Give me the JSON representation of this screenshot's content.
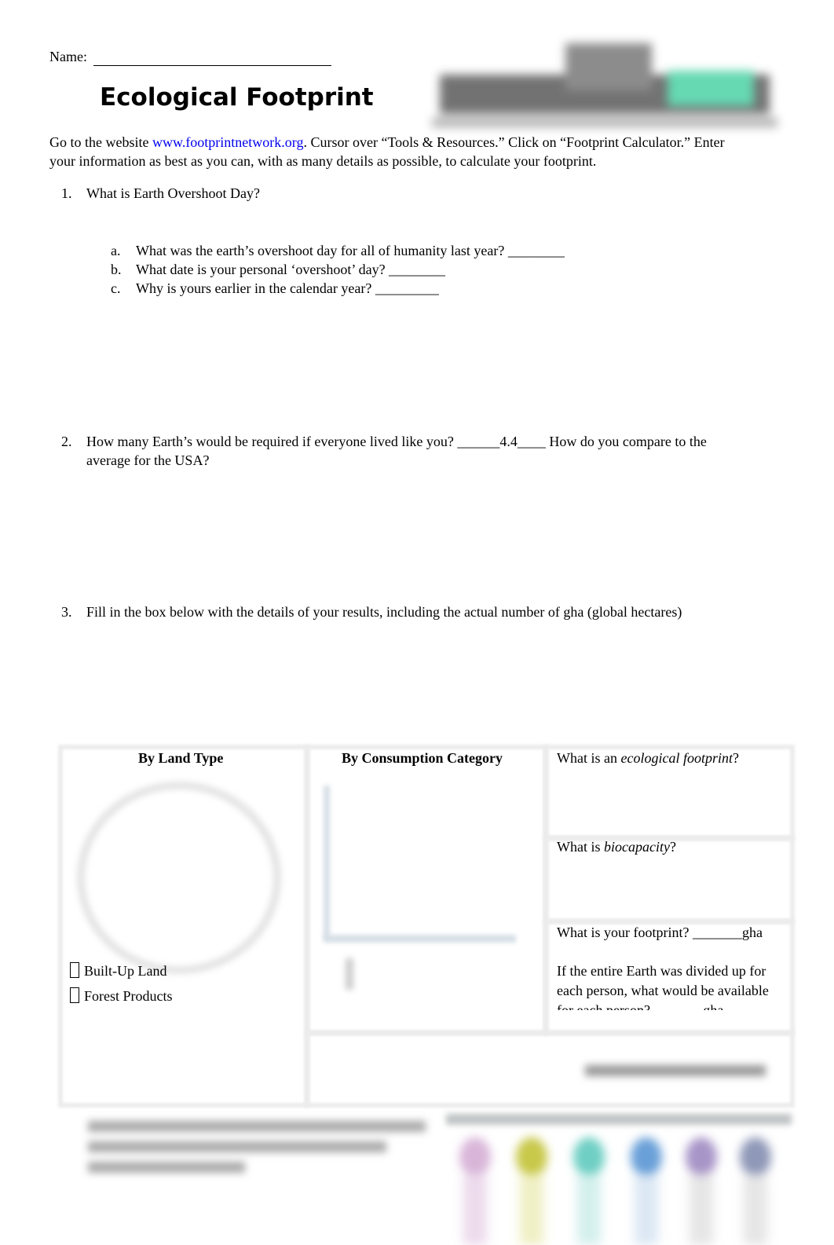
{
  "header": {
    "name_label": "Name:",
    "title": "Ecological Footprint"
  },
  "intro": {
    "pre": "Go to the website ",
    "link": "www.footprintnetwork.org",
    "post": ". Cursor over “Tools & Resources.” Click on “Footprint Calculator.” Enter",
    "line2": "your information as best as you can, with as many details as possible, to calculate your footprint."
  },
  "questions": [
    {
      "num": "1.",
      "text": "What is Earth Overshoot Day?",
      "sub": [
        {
          "letter": "a.",
          "text": "What was the earth’s overshoot day for all of humanity last year? ________"
        },
        {
          "letter": "b.",
          "text": "What date is your personal ‘overshoot’ day? ________"
        },
        {
          "letter": "c.",
          "text": "Why is yours earlier in the calendar year?  _________"
        }
      ]
    },
    {
      "num": "2.",
      "text": "How many Earth’s would be required if everyone lived like you? ______4.4____ How do you compare to the",
      "text2": "average for the USA?"
    },
    {
      "num": "3.",
      "text": "Fill in the box below with the details of your results, including the actual number of gha (global hectares)"
    }
  ],
  "box": {
    "land_type_header": "By Land Type",
    "consumption_header": "By Consumption Category",
    "legend": [
      "Built-Up Land",
      "Forest Products"
    ],
    "q_eco_pre": "What is an ",
    "q_eco_em": "ecological footprint",
    "q_eco_post": "?",
    "q_bio_pre": "What is ",
    "q_bio_em": "biocapacity",
    "q_bio_post": "?",
    "q_footprint": "What is your footprint? _______gha",
    "q_divided_1": "If the entire Earth was divided up for",
    "q_divided_2": "each person, what would be available",
    "q_divided_3": "for each person? _______gha"
  },
  "colors": {
    "link": "#0000ee",
    "bulbs": [
      "#d9b6d9",
      "#c8c84a",
      "#6fcfc4",
      "#6aa0d8",
      "#a895c8",
      "#8f98b8"
    ]
  }
}
